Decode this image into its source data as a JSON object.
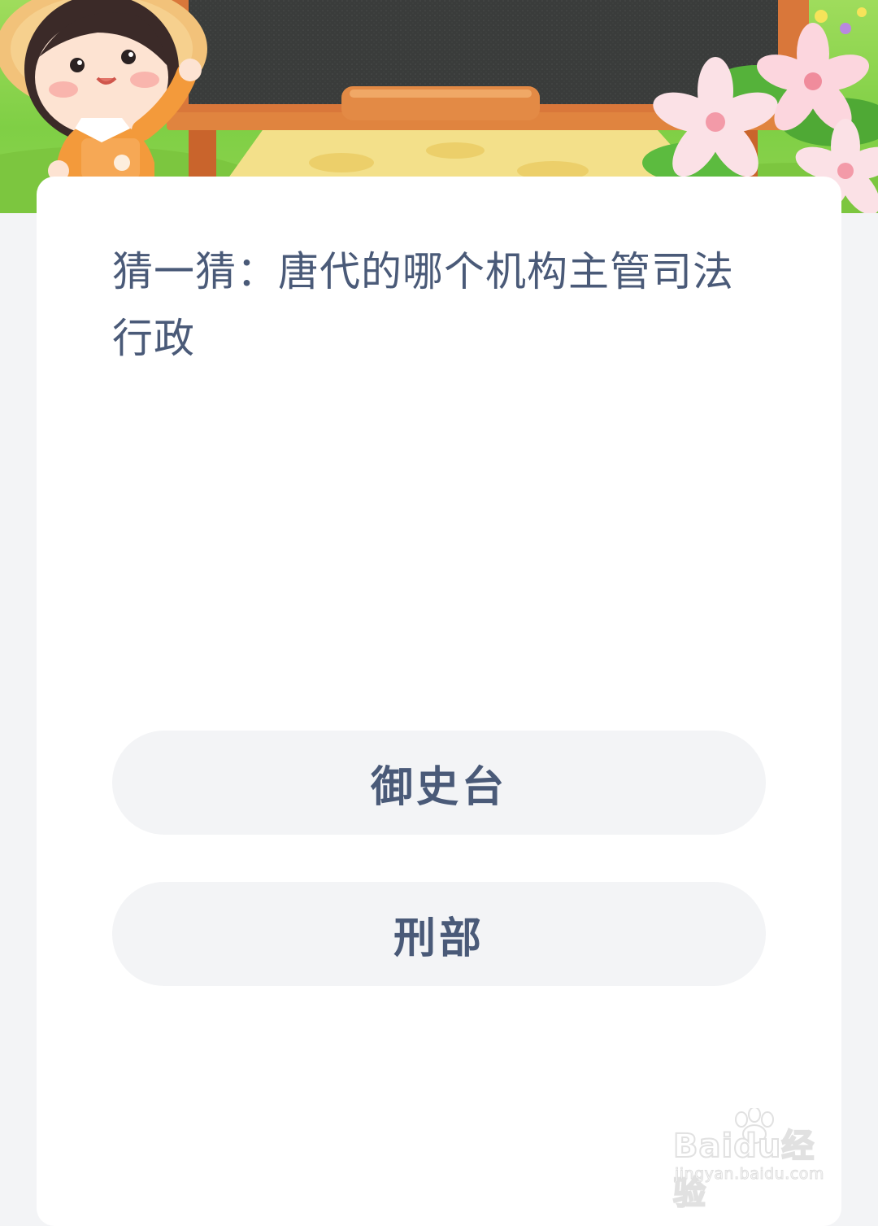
{
  "question": {
    "text": "猜一猜：唐代的哪个机构主管司法行政"
  },
  "options": [
    {
      "label": "御史台"
    },
    {
      "label": "刑部"
    }
  ],
  "watermark": {
    "logo_text": "Baidu经验",
    "url": "jingyan.baidu.com"
  },
  "colors": {
    "page_background": "#f3f4f6",
    "card_background": "#ffffff",
    "text": "#4a5a78",
    "option_background": "#f3f4f6",
    "chalkboard": "#3a3c3b",
    "board_frame": "#d9773a",
    "grass": "#8fd34f"
  },
  "icons": {
    "mascot": "farmer-girl-illustration",
    "board": "chalkboard-illustration",
    "flowers": "pink-flowers-illustration"
  }
}
